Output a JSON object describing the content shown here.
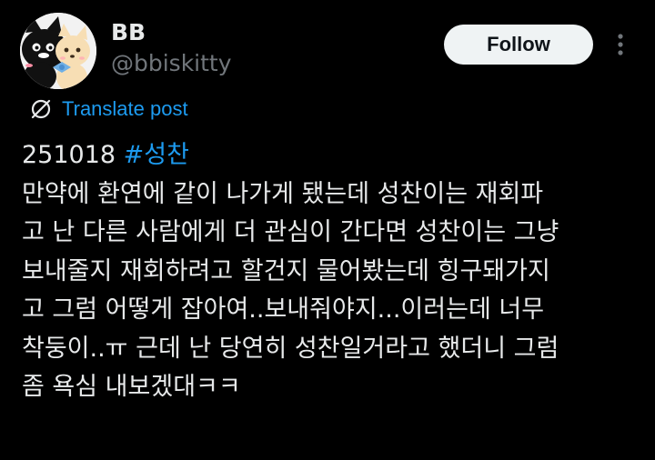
{
  "author": {
    "display_name": "BB",
    "handle": "@bbiskitty",
    "avatar_icon": "cat-avatar-icon"
  },
  "actions": {
    "follow_label": "Follow",
    "more_icon": "more-vertical-icon"
  },
  "translate": {
    "icon": "globe-translate-icon",
    "label": "Translate post"
  },
  "post": {
    "date_text": "251018 ",
    "hashtag": "#성찬",
    "lines": [
      "만약에 환연에 같이 나가게 됐는데 성찬이는 재회파",
      "고 난 다른 사람에게 더 관심이 간다면 성찬이는 그냥",
      "보내줄지 재회하려고 할건지 물어봤는데 힝구돼가지",
      "고 그럼 어떻게 잡아여..보내줘야지...이러는데 너무",
      "착둥이..ㅠ 근데 난 당연히 성찬일거라고 했더니 그럼",
      "좀 욕심 내보겠대ㅋㅋ"
    ]
  },
  "colors": {
    "background": "#000000",
    "text": "#e7e9ea",
    "muted": "#71767b",
    "link": "#1d9bf0",
    "button_bg": "#eff3f4"
  }
}
